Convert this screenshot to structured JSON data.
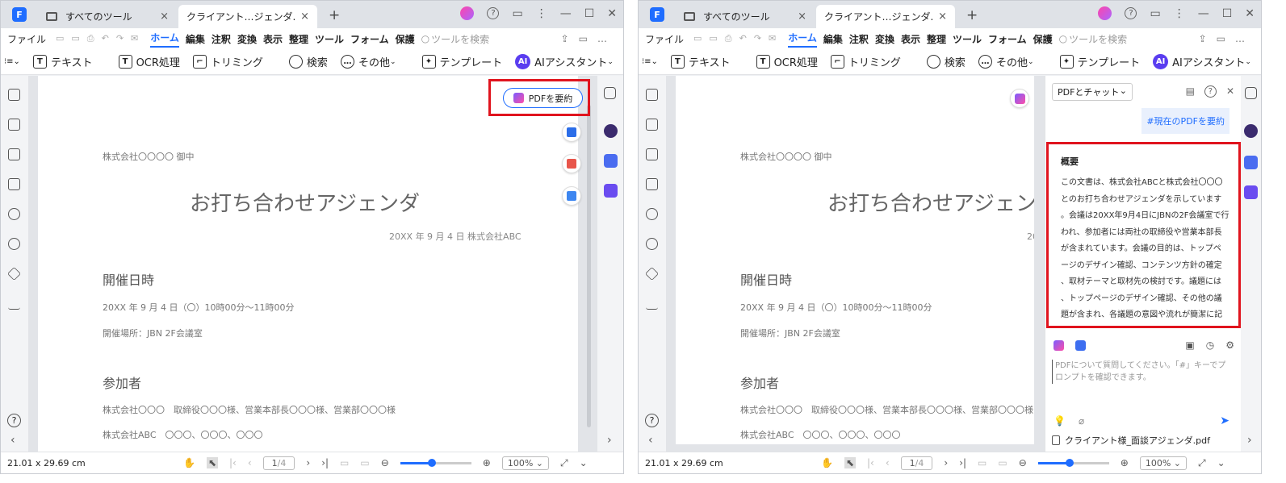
{
  "tabs": {
    "tools": "すべてのツール",
    "doc": "クライアント…ジェンダ.pdf",
    "close": "×",
    "new": "+"
  },
  "menu": {
    "file": "ファイル",
    "items": [
      "ホーム",
      "編集",
      "注釈",
      "変換",
      "表示",
      "整理",
      "ツール",
      "フォーム",
      "保護"
    ],
    "search_placeholder": "ツールを検索",
    "more": "…"
  },
  "toolbar": {
    "prev": "⁝≡⌄",
    "text": "テキスト",
    "ocr": "OCR処理",
    "crop": "トリミング",
    "search": "検索",
    "more": "その他",
    "template": "テンプレート",
    "ai": "AIアシスタント",
    "ai_badge": "AI"
  },
  "document": {
    "company": "株式会社〇〇〇〇 御中",
    "title": "お打ち合わせアジェンダ",
    "date": "20XX 年 9 月 4 日 株式会社ABC",
    "h_datetime": "開催日時",
    "datetime": "20XX 年 9 月 4 日（〇）10時00分～11時00分",
    "place": "開催場所：JBN 2F会議室",
    "h_members": "参加者",
    "member1": "株式会社〇〇〇　取締役〇〇〇様、営業本部長〇〇〇様、営業部〇〇〇様",
    "member2": "株式会社ABC　〇〇〇、〇〇〇、〇〇〇"
  },
  "summarize_button": "PDFを要約",
  "status": {
    "size": "21.01 x 29.69 cm",
    "page": "1",
    "total": "/4",
    "zoom": "100%",
    "zoom_level": 0.45
  },
  "chat": {
    "mode": "PDFとチャット",
    "user_message": "#現在のPDFを要約",
    "summary_title": "概要",
    "summary_lines": [
      "この文書は、株式会社ABCと株式会社〇〇〇",
      "とのお打ち合わせアジェンダを示しています",
      "。会議は20XX年9月4日にJBNの2F会議室で行",
      "われ、参加者には両社の取締役や営業本部長",
      "が含まれています。会議の目的は、トップペ",
      "ージのデザイン確認、コンテンツ方針の確定",
      "、取材テーマと取材先の検討です。議題には",
      "、トップページのデザイン確認、その他の議",
      "題が含まれ、各議題の意図や流れが簡潔に記"
    ],
    "placeholder": "PDFについて質問してください。「#」キーでプロンプトを確認できます。",
    "file": "クライアント様_面談アジェンダ.pdf"
  },
  "icons": {
    "help": "?",
    "chevron_left": "‹",
    "chevron_right": "›"
  },
  "colors": {
    "accent": "#1f6dff",
    "highlight": "#e0141e"
  }
}
